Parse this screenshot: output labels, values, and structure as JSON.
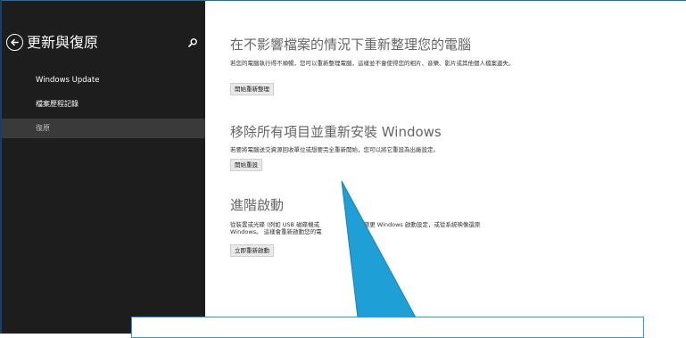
{
  "sidebar": {
    "title": "更新與復原",
    "back_icon": "back-arrow-circle-icon",
    "search_icon": "search-icon",
    "items": [
      {
        "label": "Windows Update"
      },
      {
        "label": "檔案歷程記錄"
      },
      {
        "label": "復原",
        "selected": true
      }
    ]
  },
  "sections": [
    {
      "title": "在不影響檔案的情況下重新整理您的電腦",
      "description": "若您的電腦執行得不順暢，您可以重新整理電腦，這樣並不會使得您的相片、音樂、影片或其他個人檔案遺失。",
      "button": "開始重新整理"
    },
    {
      "title": "移除所有項目並重新安裝 Windows",
      "description": "若要將電腦送交資源回收單位或想要完全重新開始，您可以將它重設為出廠設定。",
      "button": "開始重設"
    },
    {
      "title": "進階啟動",
      "description_line1": "從裝置或光碟 (例如 USB 磁碟機或",
      "description_line1b": "啟動、變更 Windows 啟動設定，或從系統映像還原",
      "description_line2": "Windows。 這樣會重新啟動您的電",
      "button": "立即重新啟動"
    }
  ],
  "colors": {
    "sidebar_bg": "#1d1d1d",
    "selected_item_bg": "#3a3a3a",
    "callout_fill": "#1e9fd6",
    "callout_stroke": "#1584b8"
  }
}
